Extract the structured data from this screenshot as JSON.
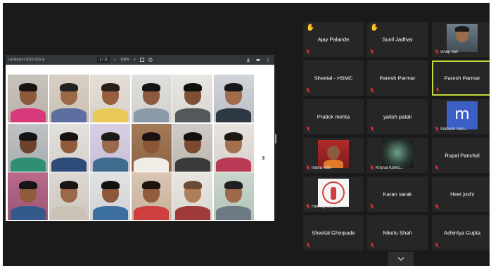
{
  "viewer": {
    "file_title": "ual Report 2020-21B.ai",
    "page_indicator": "1 / 11",
    "zoom": "100%"
  },
  "participants": [
    {
      "name": "Ajay Palande",
      "hand_raised": true
    },
    {
      "name": "Sunil Jadhav",
      "hand_raised": true
    },
    {
      "name": "vinaji nair",
      "has_video_thumb": true
    },
    {
      "name": "Sheetal - HSMC"
    },
    {
      "name": "Paresh Parmar"
    },
    {
      "name": "Paresh Parmar",
      "active_speaker": true
    },
    {
      "name": "Pratick mehta"
    },
    {
      "name": "yatish patali"
    },
    {
      "name": "Mahesh Mun...",
      "avatar_letter": "m"
    },
    {
      "name": "Indira Nair",
      "has_video_thumb": true
    },
    {
      "name": "Krunal Kotec...",
      "has_video_thumb": true
    },
    {
      "name": "Rupal Panchal"
    },
    {
      "name": "Hemophilia F...",
      "has_video_thumb": true
    },
    {
      "name": "Karan sarak"
    },
    {
      "name": "Heet joshi"
    },
    {
      "name": "Sheetal Ghorpade"
    },
    {
      "name": "Niketu Shah"
    },
    {
      "name": "Achintya Gupta"
    }
  ],
  "colors": {
    "background": "#1a1a1a",
    "tile": "#262626",
    "active_border": "#c2d83b",
    "muted_mic": "#e03a3a",
    "raised_hand": "#f2b705"
  },
  "icons": {
    "raised_hand": "raised-hand-icon",
    "muted_mic": "mic-muted-icon",
    "show_more": "chevron-down-icon"
  }
}
